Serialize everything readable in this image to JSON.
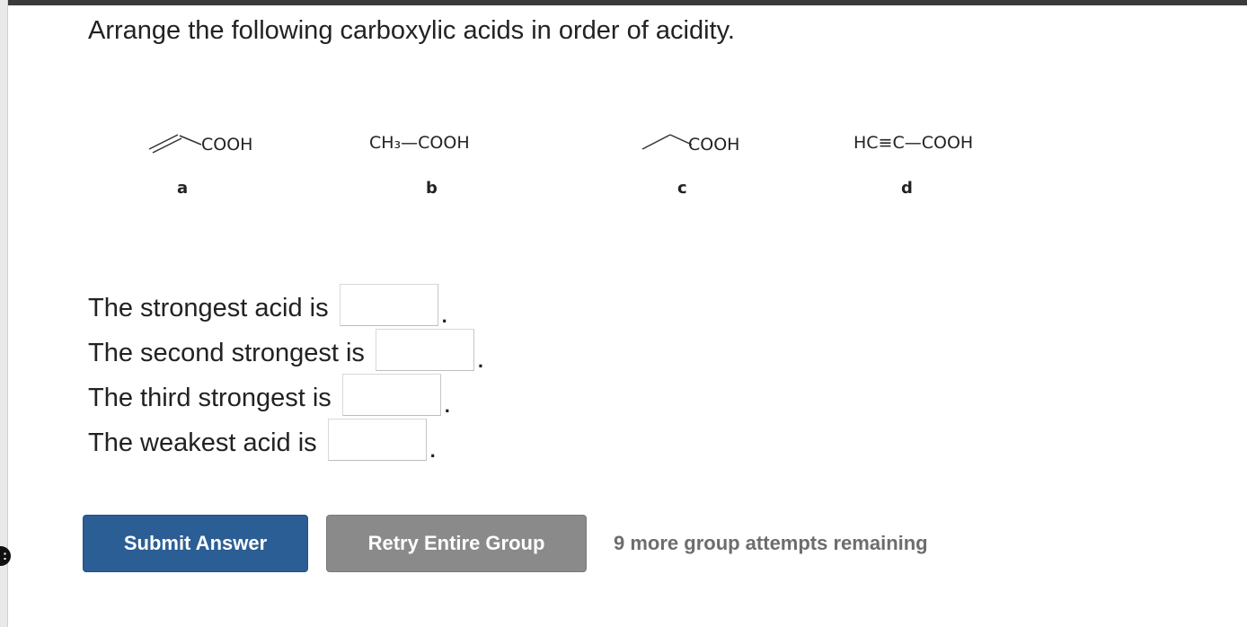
{
  "question": "Arrange the following carboxylic acids in order of acidity.",
  "structures": [
    {
      "letter": "a",
      "formula": "COOH"
    },
    {
      "letter": "b",
      "formula": "CH₃—COOH"
    },
    {
      "letter": "c",
      "formula": "COOH"
    },
    {
      "letter": "d",
      "formula": "HC≡C—COOH"
    }
  ],
  "answers": [
    {
      "label": "The strongest acid is",
      "value": ""
    },
    {
      "label": "The second strongest is",
      "value": ""
    },
    {
      "label": "The third strongest is",
      "value": ""
    },
    {
      "label": "The weakest acid is",
      "value": ""
    }
  ],
  "period": ".",
  "buttons": {
    "submit": "Submit Answer",
    "retry": "Retry Entire Group"
  },
  "attempts_text": "9 more group attempts remaining",
  "colors": {
    "submit_bg": "#2b5e94",
    "retry_bg": "#8a8a8a",
    "attempts_text": "#6d6d6d"
  }
}
